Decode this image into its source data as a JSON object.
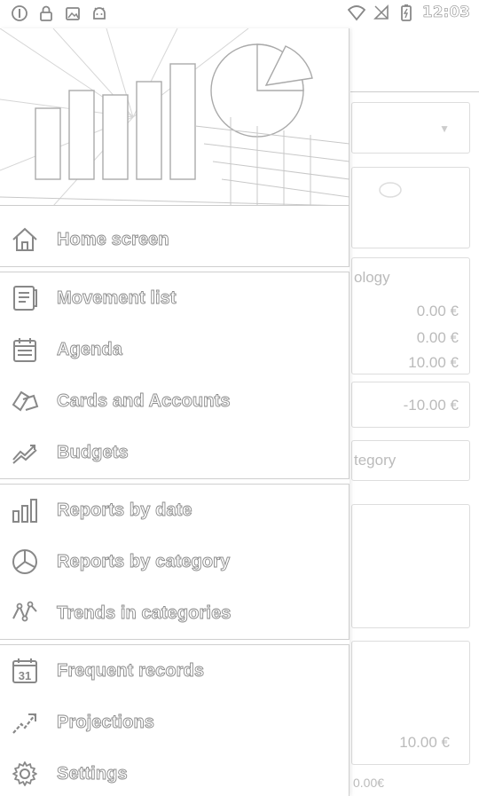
{
  "status_bar": {
    "time": "12:03"
  },
  "background": {
    "visible_fragments": [
      "ology",
      "0.00 €",
      "0.00 €",
      "10.00 €",
      "-10.00 €",
      "tegory",
      "10.00 €",
      "0.00€"
    ]
  },
  "drawer": {
    "sections": [
      {
        "items": [
          {
            "label": "Home screen",
            "icon": "home-icon",
            "active": true
          }
        ]
      },
      {
        "items": [
          {
            "label": "Movement list",
            "icon": "list-icon"
          },
          {
            "label": "Agenda",
            "icon": "calendar-icon"
          },
          {
            "label": "Cards and Accounts",
            "icon": "cards-icon"
          },
          {
            "label": "Budgets",
            "icon": "budget-icon"
          }
        ]
      },
      {
        "items": [
          {
            "label": "Reports by date",
            "icon": "bar-chart-icon"
          },
          {
            "label": "Reports by category",
            "icon": "pie-chart-icon"
          },
          {
            "label": "Trends in categories",
            "icon": "trend-icon"
          }
        ]
      },
      {
        "items": [
          {
            "label": "Frequent records",
            "icon": "calendar-31-icon"
          },
          {
            "label": "Projections",
            "icon": "projection-icon"
          },
          {
            "label": "Settings",
            "icon": "gear-icon"
          }
        ]
      }
    ]
  }
}
